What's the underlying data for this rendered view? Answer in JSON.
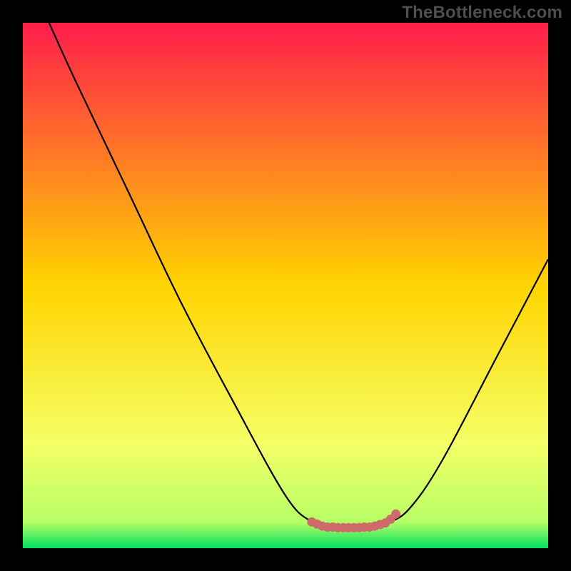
{
  "watermark": "TheBottleneck.com",
  "chart_data": {
    "type": "line",
    "title": "",
    "xlabel": "",
    "ylabel": "",
    "xlim": [
      0,
      100
    ],
    "ylim": [
      0,
      100
    ],
    "background_gradient": {
      "stops": [
        {
          "offset": 0,
          "color": "#ff1d4b"
        },
        {
          "offset": 50,
          "color": "#ffd400"
        },
        {
          "offset": 80,
          "color": "#f5ff66"
        },
        {
          "offset": 95,
          "color": "#b7ff66"
        },
        {
          "offset": 100,
          "color": "#00e060"
        }
      ]
    },
    "curve_points": [
      {
        "x": 5,
        "y": 100
      },
      {
        "x": 10,
        "y": 89
      },
      {
        "x": 20,
        "y": 68
      },
      {
        "x": 30,
        "y": 47
      },
      {
        "x": 40,
        "y": 28
      },
      {
        "x": 50,
        "y": 10
      },
      {
        "x": 55,
        "y": 5
      },
      {
        "x": 58,
        "y": 4
      },
      {
        "x": 62,
        "y": 4
      },
      {
        "x": 66,
        "y": 4
      },
      {
        "x": 70,
        "y": 5
      },
      {
        "x": 74,
        "y": 8
      },
      {
        "x": 80,
        "y": 17
      },
      {
        "x": 90,
        "y": 36
      },
      {
        "x": 100,
        "y": 55
      }
    ],
    "marker_points": [
      {
        "x": 55,
        "y": 5
      },
      {
        "x": 56,
        "y": 4.6
      },
      {
        "x": 57,
        "y": 4.2
      },
      {
        "x": 58,
        "y": 4
      },
      {
        "x": 59,
        "y": 4
      },
      {
        "x": 60,
        "y": 3.9
      },
      {
        "x": 61,
        "y": 3.9
      },
      {
        "x": 62,
        "y": 3.9
      },
      {
        "x": 63,
        "y": 3.9
      },
      {
        "x": 64,
        "y": 3.9
      },
      {
        "x": 65,
        "y": 4
      },
      {
        "x": 66,
        "y": 4
      },
      {
        "x": 67,
        "y": 4.2
      },
      {
        "x": 68,
        "y": 4.5
      },
      {
        "x": 69,
        "y": 4.8
      },
      {
        "x": 70,
        "y": 5.5
      },
      {
        "x": 71,
        "y": 6.5
      }
    ],
    "curve_color": "#000000",
    "marker_color": "#cf6a6a"
  }
}
